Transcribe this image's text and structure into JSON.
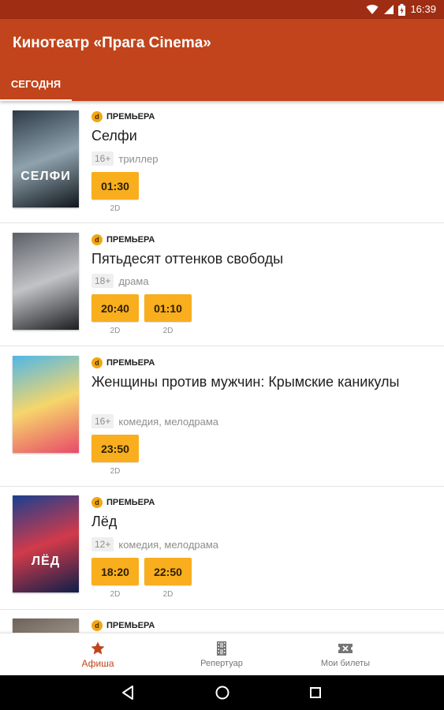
{
  "status_bar": {
    "time": "16:39",
    "wifi_icon": "wifi-icon",
    "signal_icon": "signal-icon",
    "battery_icon": "battery-icon"
  },
  "app_bar": {
    "title": "Кинотеатр «Прага Cinema»",
    "tabs": [
      {
        "label": "СЕГОДНЯ",
        "active": true
      }
    ]
  },
  "movies": [
    {
      "badge": "ПРЕМЬЕРА",
      "title": "Селфи",
      "age": "16+",
      "genre": "триллер",
      "poster_text": "СЕЛФИ",
      "poster_colors": [
        "#2c3a46",
        "#8fa2ad",
        "#10161c"
      ],
      "sessions": [
        {
          "time": "01:30",
          "format": "2D"
        }
      ]
    },
    {
      "badge": "ПРЕМЬЕРА",
      "title": "Пятьдесят оттенков свободы",
      "age": "18+",
      "genre": "драма",
      "poster_text": "",
      "poster_colors": [
        "#5b5f66",
        "#c2c3c6",
        "#1c1d21"
      ],
      "sessions": [
        {
          "time": "20:40",
          "format": "2D"
        },
        {
          "time": "01:10",
          "format": "2D"
        }
      ]
    },
    {
      "badge": "ПРЕМЬЕРА",
      "title": "Женщины против мужчин: Крымские каникулы",
      "age": "16+",
      "genre": "комедия, мелодрама",
      "poster_text": "",
      "poster_colors": [
        "#4fb7e8",
        "#f6d66b",
        "#e84a6a"
      ],
      "sessions": [
        {
          "time": "23:50",
          "format": "2D"
        }
      ]
    },
    {
      "badge": "ПРЕМЬЕРА",
      "title": "Лёд",
      "age": "12+",
      "genre": "комедия, мелодрама",
      "poster_text": "ЛЁД",
      "poster_colors": [
        "#1b3f8f",
        "#d23a4a",
        "#0e1f4a"
      ],
      "sessions": [
        {
          "time": "18:20",
          "format": "2D"
        },
        {
          "time": "22:50",
          "format": "2D"
        }
      ]
    },
    {
      "badge": "ПРЕМЬЕРА",
      "title": "",
      "age": "",
      "genre": "",
      "poster_text": "",
      "poster_colors": [
        "#6d6259",
        "#b3a89c",
        "#3a3330"
      ],
      "sessions": []
    }
  ],
  "bottom_nav": [
    {
      "label": "Афиша",
      "icon": "star-icon",
      "active": true
    },
    {
      "label": "Репертуар",
      "icon": "film-icon",
      "active": false
    },
    {
      "label": "Мои билеты",
      "icon": "ticket-icon",
      "active": false
    }
  ],
  "system_nav": {
    "back_icon": "back-icon",
    "home_icon": "home-icon",
    "recents_icon": "recents-icon"
  },
  "colors": {
    "primary": "#c1441c",
    "primary_dark": "#9e2d13",
    "accent": "#f9ae1e",
    "badge": "#f3a614"
  }
}
